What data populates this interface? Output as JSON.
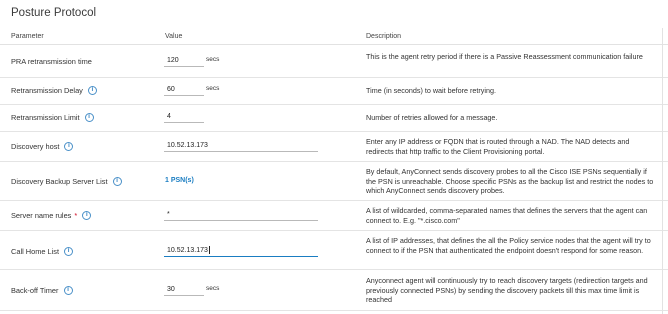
{
  "title": "Posture Protocol",
  "headers": {
    "param": "Parameter",
    "value": "Value",
    "desc": "Description"
  },
  "rows": [
    {
      "name": "PRA retransmission time",
      "info": false,
      "required": false,
      "value": "120",
      "units": "secs",
      "desc": "This is the agent retry period if there is a Passive Reassessment communication failure"
    },
    {
      "name": "Retransmission Delay",
      "info": true,
      "required": false,
      "value": "60",
      "units": "secs",
      "desc": "Time (in seconds) to wait before retrying."
    },
    {
      "name": "Retransmission Limit",
      "info": true,
      "required": false,
      "value": "4",
      "desc": "Number of retries allowed for a message."
    },
    {
      "name": "Discovery host",
      "info": true,
      "required": false,
      "value": "10.52.13.173",
      "desc": "Enter any IP address or FQDN that is routed through a NAD. The NAD detects and redirects that http traffic to the Client Provisioning portal."
    },
    {
      "name": "Discovery Backup Server List",
      "info": true,
      "required": false,
      "link": "1 PSN(s)",
      "desc": "By default, AnyConnect sends discovery probes to all the Cisco ISE PSNs sequentially if the PSN is unreachable. Choose specific PSNs as the backup list and restrict the nodes to which AnyConnect sends discovery probes."
    },
    {
      "name": "Server name rules",
      "info": true,
      "required": true,
      "required_mark": "*",
      "value": "*",
      "desc": "A list of wildcarded, comma-separated names that defines the servers that the agent can connect to. E.g. \"*.cisco.com\""
    },
    {
      "name": "Call Home List",
      "info": true,
      "required": false,
      "value": "10.52.13.173",
      "desc": "A list of IP addresses, that defines the all the Policy service nodes that the agent will try to connect to if the PSN that authenticated the endpoint doesn't respond for some reason."
    },
    {
      "name": "Back-off Timer",
      "info": true,
      "required": false,
      "value": "30",
      "units": "secs",
      "desc": "Anyconnect agent will continuously try to reach discovery targets (redirection targets and previously connected PSNs) by sending the discovery packets till this max time limit is reached"
    }
  ],
  "colors": {
    "accent": "#1a7dc2",
    "required": "#d0021b",
    "info_icon": "#4a90c8"
  },
  "icons": {
    "info": "info-circle-icon",
    "info_glyph": "i"
  }
}
